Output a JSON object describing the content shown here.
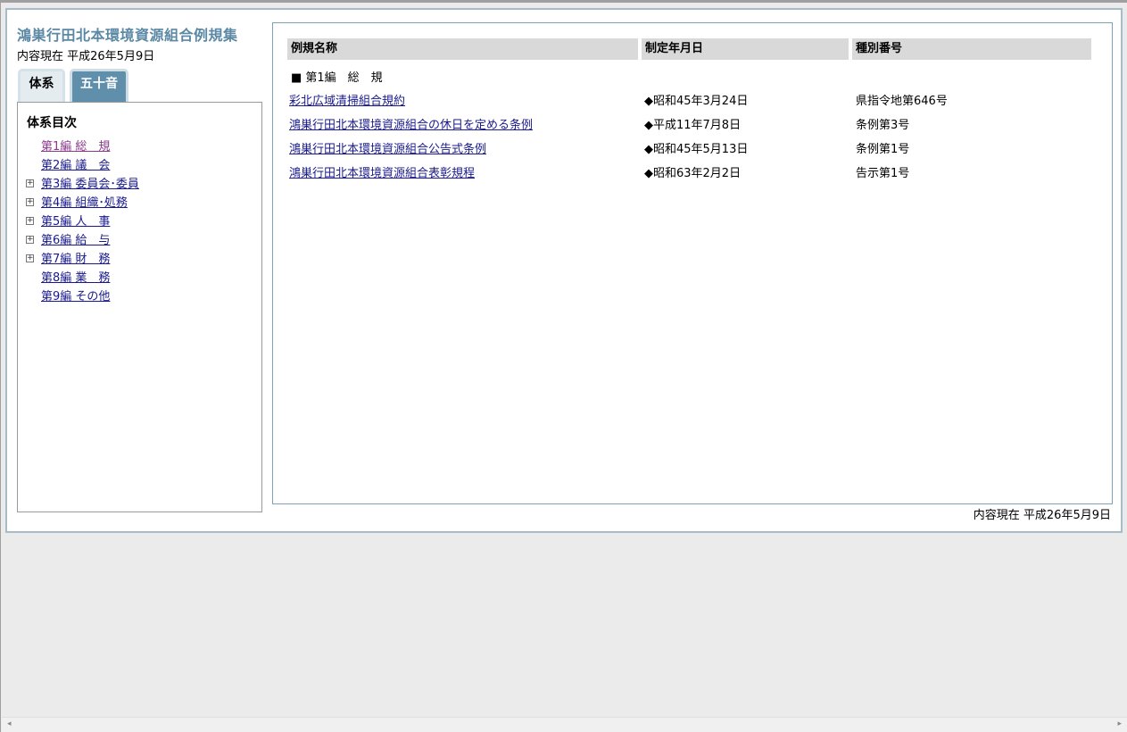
{
  "header": {
    "title": "鴻巣行田北本環境資源組合例規集",
    "date_label": "内容現在 平成26年5月9日"
  },
  "tabs": [
    {
      "label": "体系",
      "active": true
    },
    {
      "label": "五十音",
      "active": false
    }
  ],
  "sidebar": {
    "heading": "体系目次",
    "items": [
      {
        "label": "第1編 総　規",
        "expandable": false,
        "visited": true
      },
      {
        "label": "第2編 議　会",
        "expandable": false,
        "visited": false
      },
      {
        "label": "第3編 委員会･委員",
        "expandable": true,
        "visited": false
      },
      {
        "label": "第4編 組織･処務",
        "expandable": true,
        "visited": false
      },
      {
        "label": "第5編 人　事",
        "expandable": true,
        "visited": false
      },
      {
        "label": "第6編 給　与",
        "expandable": true,
        "visited": false
      },
      {
        "label": "第7編 財　務",
        "expandable": true,
        "visited": false
      },
      {
        "label": "第8編 業　務",
        "expandable": false,
        "visited": false
      },
      {
        "label": "第9編 その他",
        "expandable": false,
        "visited": false
      }
    ],
    "expand_glyph": "+"
  },
  "table": {
    "headers": {
      "name": "例規名称",
      "date": "制定年月日",
      "type": "種別番号"
    },
    "section": "■ 第1編　総　規",
    "rows": [
      {
        "name": "彩北広域清掃組合規約",
        "date": "◆昭和45年3月24日",
        "type": "県指令地第646号"
      },
      {
        "name": "鴻巣行田北本環境資源組合の休日を定める条例",
        "date": "◆平成11年7月8日",
        "type": "条例第3号"
      },
      {
        "name": "鴻巣行田北本環境資源組合公告式条例",
        "date": "◆昭和45年5月13日",
        "type": "条例第1号"
      },
      {
        "name": "鴻巣行田北本環境資源組合表彰規程",
        "date": "◆昭和63年2月2日",
        "type": "告示第1号"
      }
    ]
  },
  "footer": {
    "date_label": "内容現在 平成26年5月9日"
  },
  "scrollbar": {
    "left_glyph": "◂",
    "right_glyph": "▸"
  },
  "colors": {
    "title": "#5b88a4",
    "link": "#1a1a8c",
    "visited_link": "#8a3a8a",
    "active_tab_bg": "#5f8fab"
  }
}
